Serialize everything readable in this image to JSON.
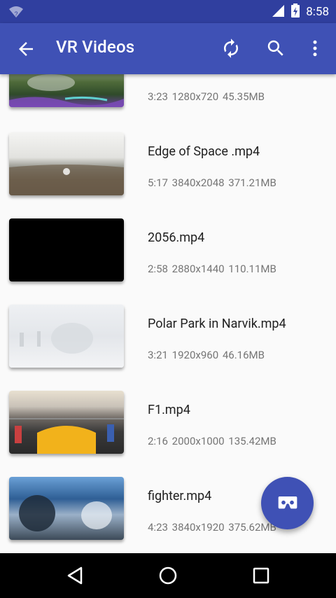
{
  "status": {
    "time": "8:58",
    "wifi_badge": "?"
  },
  "toolbar": {
    "title": "VR Videos",
    "icons": [
      "back-arrow-icon",
      "refresh-icon",
      "search-icon",
      "more-vert-icon"
    ]
  },
  "videos": [
    {
      "name": "",
      "duration": "3:23",
      "resolution": "1280x720",
      "size": "45.35MB"
    },
    {
      "name": "Edge of Space .mp4",
      "duration": "5:17",
      "resolution": "3840x2048",
      "size": "371.21MB"
    },
    {
      "name": "2056.mp4",
      "duration": "2:58",
      "resolution": "2880x1440",
      "size": "110.11MB"
    },
    {
      "name": "Polar Park in Narvik.mp4",
      "duration": "3:21",
      "resolution": "1920x960",
      "size": "46.16MB"
    },
    {
      "name": "F1.mp4",
      "duration": "2:16",
      "resolution": "2000x1000",
      "size": "135.42MB"
    },
    {
      "name": "fighter.mp4",
      "duration": "4:23",
      "resolution": "3840x1920",
      "size": "375.62MB"
    }
  ],
  "fab": {
    "icon": "vr-headset-icon"
  },
  "nav": {
    "icons": [
      "nav-back-icon",
      "nav-home-icon",
      "nav-recents-icon"
    ]
  }
}
